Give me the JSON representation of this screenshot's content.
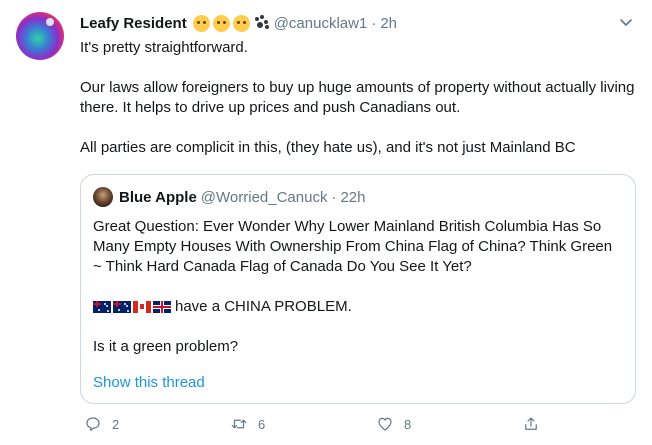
{
  "tweet": {
    "display_name": "Leafy Resident",
    "name_emojis": [
      "thinking-face-emoji",
      "frowning-face-emoji",
      "raised-eyebrow-face-emoji",
      "paw-prints-emoji"
    ],
    "handle": "@canucklaw1",
    "separator": "·",
    "time": "2h",
    "paragraphs": [
      "It's pretty straightforward.",
      "Our laws allow foreigners to buy up huge amounts of property without actually living there. It helps to drive up prices and push Canadians out.",
      "All parties are complicit in this, (they hate us), and it's not just Mainland BC"
    ]
  },
  "quoted_tweet": {
    "display_name": "Blue Apple",
    "handle": "@Worried_Canuck",
    "separator": "·",
    "time": "22h",
    "text_1": "Great Question:  Ever Wonder Why Lower Mainland British Columbia Has So Many Empty Houses With Ownership From China Flag of China? Think Green ~ Think Hard Canada Flag of Canada Do You See It Yet?",
    "flags": [
      "australia-flag",
      "australia-flag",
      "canada-flag",
      "united-kingdom-flag"
    ],
    "text_2": "have a CHINA PROBLEM.",
    "text_3": "Is it a green problem?",
    "show_thread": "Show this thread"
  },
  "actions": {
    "reply_count": "2",
    "retweet_count": "6",
    "like_count": "8"
  },
  "colors": {
    "text": "#14171a",
    "secondary": "#657786",
    "link": "#1b95e0",
    "border": "#ccd6dd"
  }
}
